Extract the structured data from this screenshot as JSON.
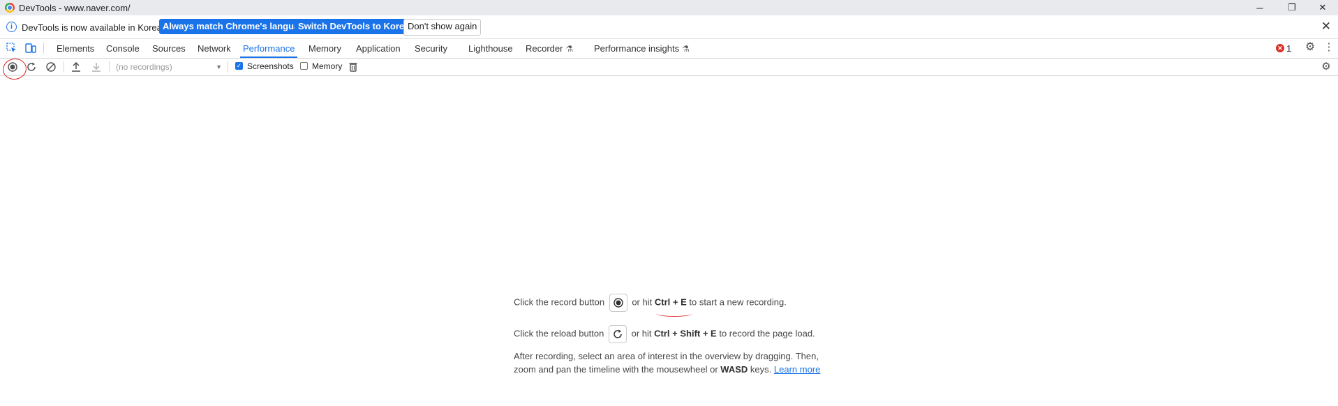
{
  "window": {
    "title": "DevTools - www.naver.com/",
    "minimize": "─",
    "restore": "❐",
    "close": "✕"
  },
  "infobar": {
    "message": "DevTools is now available in Korean!",
    "match_language_label": "Always match Chrome's language",
    "switch_korean_label": "Switch DevTools to Korean",
    "dont_show_label": "Don't show again",
    "close_glyph": "✕"
  },
  "tabs": [
    {
      "label": "Elements"
    },
    {
      "label": "Console"
    },
    {
      "label": "Sources"
    },
    {
      "label": "Network"
    },
    {
      "label": "Performance",
      "active": true
    },
    {
      "label": "Memory"
    },
    {
      "label": "Application"
    },
    {
      "label": "Security"
    },
    {
      "label": "Lighthouse"
    },
    {
      "label": "Recorder"
    },
    {
      "label": "Performance insights"
    }
  ],
  "error_count": "1",
  "toolbar": {
    "recordings_placeholder": "(no recordings)",
    "screenshots_label": "Screenshots",
    "screenshots_checked": true,
    "memory_label": "Memory",
    "memory_checked": false
  },
  "landing": {
    "record_before": "Click the record button",
    "record_mid": "or hit",
    "record_keys": "Ctrl + E",
    "record_after": "to start a new recording.",
    "reload_before": "Click the reload button",
    "reload_mid": "or hit",
    "reload_keys": "Ctrl + Shift + E",
    "reload_after": "to record the page load.",
    "after_line1": "After recording, select an area of interest in the overview by dragging. Then,",
    "after_line2_before": "zoom and pan the timeline with the mousewheel or",
    "after_line2_keys": "WASD",
    "after_line2_after": "keys.",
    "learn_more": "Learn more"
  },
  "colors": {
    "accent": "#1a73e8",
    "annotation": "#e02020",
    "error": "#d93025"
  }
}
